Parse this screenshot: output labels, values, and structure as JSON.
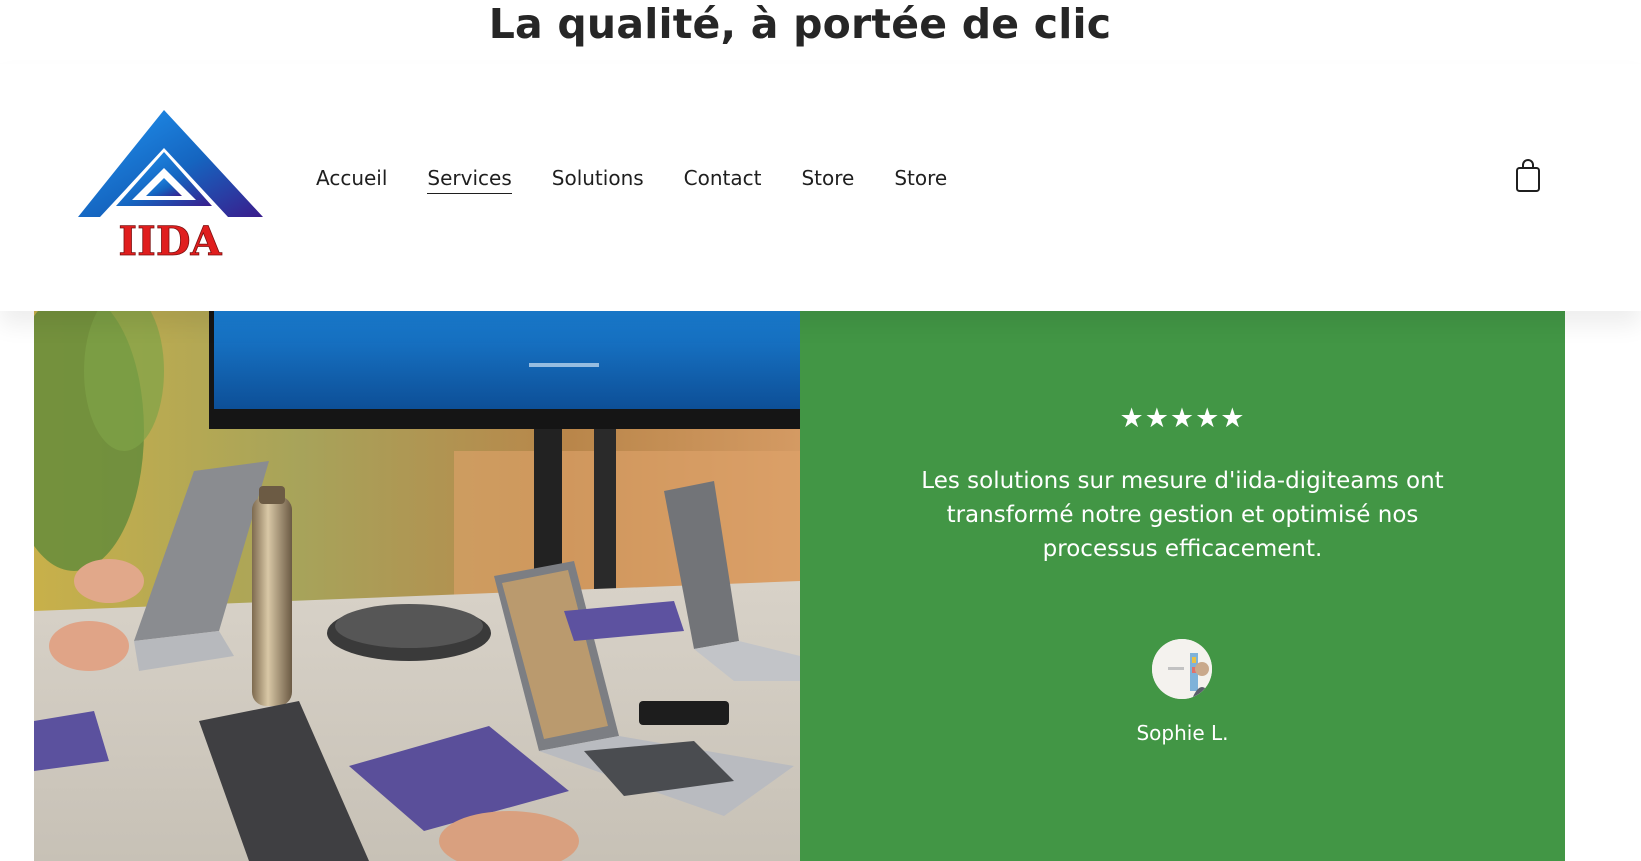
{
  "page": {
    "tagline": "La qualité, à portée de clic"
  },
  "header": {
    "logo": {
      "text": "IIDA",
      "icon": "iida-triangle-logo"
    },
    "nav": [
      {
        "label": "Accueil",
        "active": false
      },
      {
        "label": "Services",
        "active": true
      },
      {
        "label": "Solutions",
        "active": false
      },
      {
        "label": "Contact",
        "active": false
      },
      {
        "label": "Store",
        "active": false
      },
      {
        "label": "Store",
        "active": false
      }
    ],
    "cart_icon": "shopping-bag-icon"
  },
  "hero": {
    "image": "office-meeting-photo",
    "testimonial": {
      "rating": 5,
      "stars": "★★★★★",
      "quote": "Les solutions sur mesure d'iida-digiteams ont transformé notre gestion et optimisé nos processus efficacement.",
      "author": "Sophie L.",
      "avatar": "avatar-photo"
    }
  },
  "colors": {
    "testimonial_bg": "#429645",
    "logo_blue": "#1565c0",
    "logo_red": "#e01e1e",
    "text": "#1f1f1f"
  }
}
